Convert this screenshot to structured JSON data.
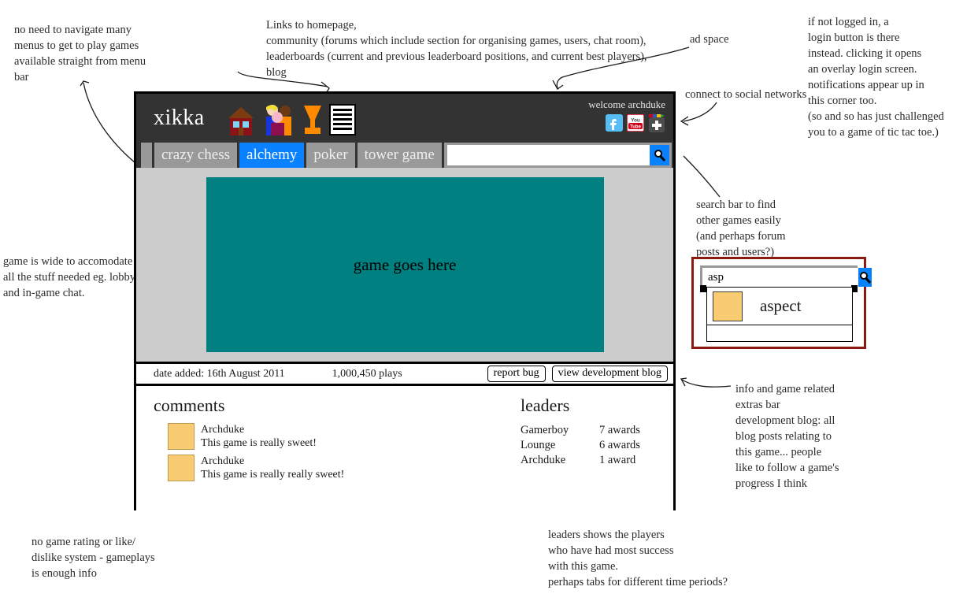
{
  "site": {
    "brand": "xikka",
    "welcome": "welcome archduke",
    "header_icons": [
      {
        "name": "house-icon",
        "title": "homepage"
      },
      {
        "name": "people-icon",
        "title": "community"
      },
      {
        "name": "trophy-icon",
        "title": "leaderboards"
      },
      {
        "name": "document-icon",
        "title": "blog"
      }
    ],
    "social": [
      {
        "name": "facebook-icon",
        "label": "f"
      },
      {
        "name": "youtube-icon",
        "label": "You Tube"
      },
      {
        "name": "googleplus-icon",
        "label": "+"
      }
    ]
  },
  "nav": {
    "tabs": [
      {
        "label": "crazy chess",
        "active": false
      },
      {
        "label": "alchemy",
        "active": true
      },
      {
        "label": "poker",
        "active": false
      },
      {
        "label": "tower game",
        "active": false
      }
    ],
    "search": {
      "value": "",
      "placeholder": "",
      "icon": "search-icon"
    }
  },
  "stage": {
    "placeholder": "game goes here"
  },
  "info_bar": {
    "date_added": "date added: 16th August 2011",
    "plays": "1,000,450 plays",
    "report_bug_label": "report bug",
    "dev_blog_label": "view development blog"
  },
  "comments": {
    "title": "comments",
    "items": [
      {
        "author": "Archduke",
        "body": "This game is really sweet!"
      },
      {
        "author": "Archduke",
        "body": "This game is really really sweet!"
      }
    ]
  },
  "leaders": {
    "title": "leaders",
    "rows": [
      {
        "name": "Gamerboy",
        "awards": "7 awards"
      },
      {
        "name": "Lounge",
        "awards": "6 awards"
      },
      {
        "name": "Archduke",
        "awards": "1 award"
      }
    ]
  },
  "search_callout": {
    "query": "asp",
    "suggestion": "aspect",
    "border_color": "#8b1a12"
  },
  "annotations": {
    "menu_bar": "no need to navigate many\nmenus to get to play games\navailable straight from menu\nbar",
    "links": "Links to homepage,\ncommunity (forums which include section for organising games, users, chat room),\nleaderboards (current and previous leaderboard positions, and current best players),\nblog",
    "ad_space": "ad space",
    "login": "if not logged in, a\nlogin button is there\ninstead. clicking it opens\nan overlay login screen.\nnotifications appear up in\nthis corner too.\n(so and so has just challenged\nyou to a game of tic tac toe.)",
    "social": "connect to social networks",
    "search_bar": "search bar to find\nother games easily\n(and perhaps forum\nposts and users?)",
    "game_wide": "game is wide to accomodate\nall the stuff needed eg. lobby\nand in-game chat.",
    "extras_bar": "info and game related\nextras bar\ndevelopment blog: all\nblog posts relating to\nthis game... people\nlike to follow a game's\nprogress I think",
    "no_rating": "no game rating or like/\ndislike system - gameplays\nis enough info",
    "leaders_note": "leaders shows the players\nwho have had most success\nwith this game.\nperhaps tabs for different time periods?"
  },
  "colors": {
    "header_bg": "#333333",
    "nav_item_bg": "#999999",
    "active_tab": "#0a82ff",
    "stage_bg": "#cccccc",
    "game_bg": "#008080",
    "avatar": "#f9cb72"
  }
}
